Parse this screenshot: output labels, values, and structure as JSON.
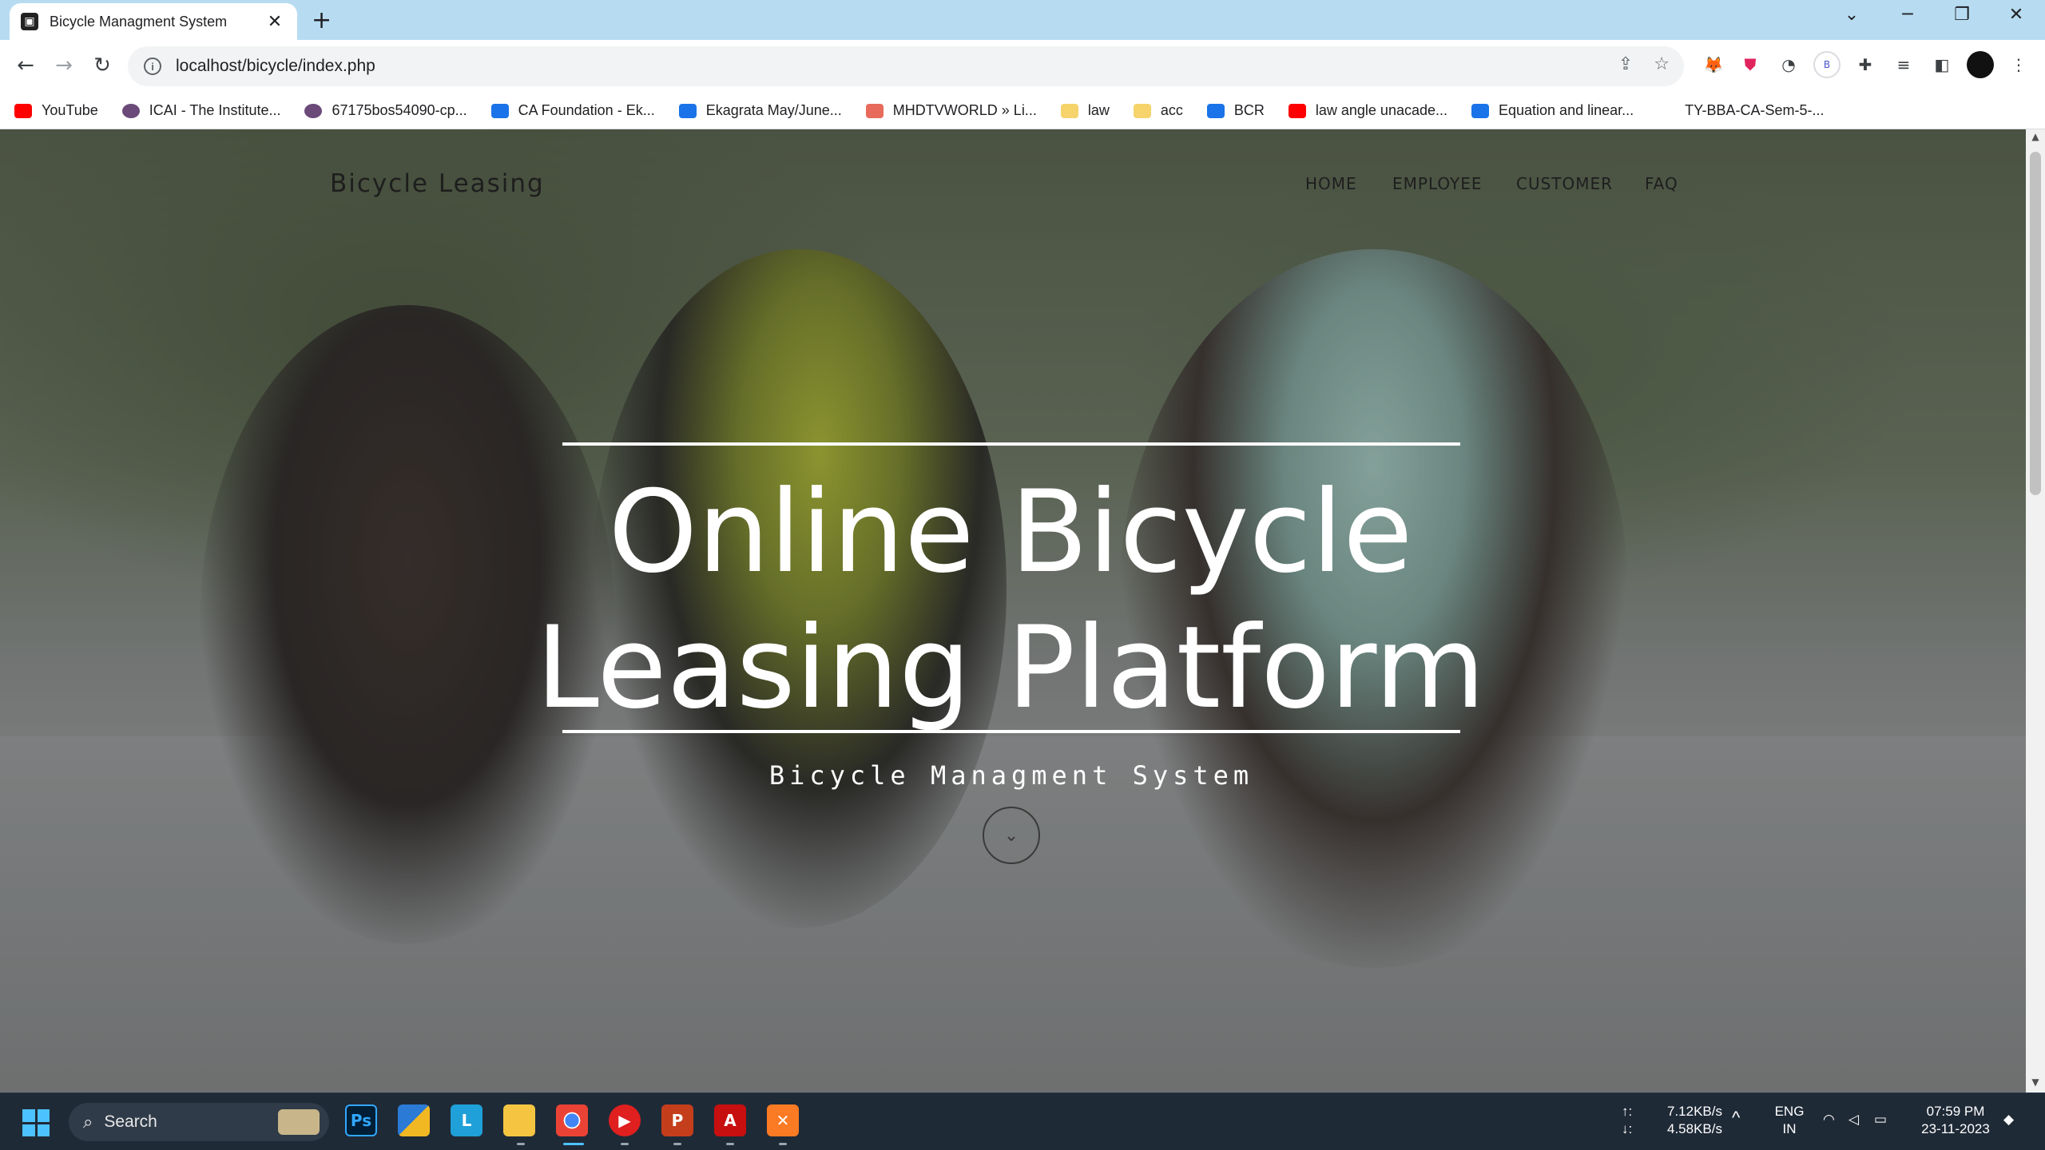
{
  "browser": {
    "tab_title": "Bicycle Managment System",
    "tab_close": "✕",
    "new_tab": "+",
    "url": "localhost/bicycle/index.php",
    "controls": {
      "dropdown": "⌄",
      "minimize": "─",
      "restore": "❐",
      "close": "✕"
    },
    "nav": {
      "back": "←",
      "forward": "→",
      "reload": "↻"
    },
    "omnibox_icons": {
      "info": "i",
      "share": "⇪",
      "bookmark": "☆"
    }
  },
  "bookmarks": [
    {
      "label": "YouTube",
      "color": "#ff0000"
    },
    {
      "label": "ICAI - The Institute...",
      "color": "#6b4a7a"
    },
    {
      "label": "67175bos54090-cp...",
      "color": "#6b4a7a"
    },
    {
      "label": "CA Foundation - Ek...",
      "color": "#1a73e8"
    },
    {
      "label": "Ekagrata May/June...",
      "color": "#1a73e8"
    },
    {
      "label": "MHDTVWORLD » Li...",
      "color": "#e86a5a"
    },
    {
      "label": "law",
      "color": "#f6d36b"
    },
    {
      "label": "acc",
      "color": "#f6d36b"
    },
    {
      "label": "BCR",
      "color": "#1a73e8"
    },
    {
      "label": "law angle unacade...",
      "color": "#ff0000"
    },
    {
      "label": "Equation and linear...",
      "color": "#1a73e8"
    },
    {
      "label": "TY-BBA-CA-Sem-5-...",
      "color": "#ffffff"
    }
  ],
  "site": {
    "brand": "Bicycle Leasing",
    "menu": [
      "HOME",
      "EMPLOYEE",
      "CUSTOMER",
      "FAQ"
    ],
    "hero_line1": "Online Bicycle",
    "hero_line2": "Leasing Platform",
    "hero_subtitle": "Bicycle Managment System",
    "scroll_icon": "⌄"
  },
  "taskbar": {
    "search_label": "Search",
    "network_up": "7.12KB/s",
    "network_down": "4.58KB/s",
    "up_arrow": "↑:",
    "down_arrow": "↓:",
    "lang1": "ENG",
    "lang2": "IN",
    "time": "07:59 PM",
    "date": "23-11-2023",
    "chevron": "^"
  }
}
